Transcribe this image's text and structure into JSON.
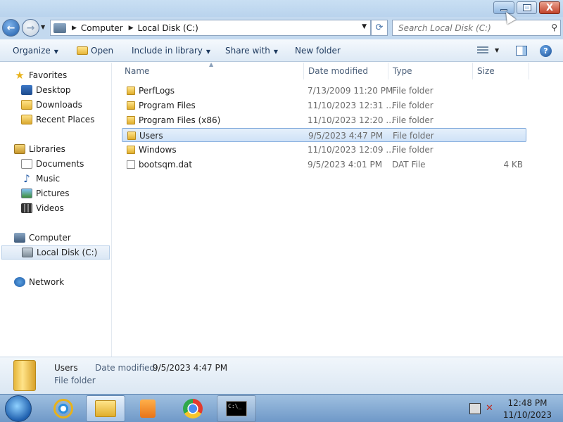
{
  "window": {
    "minimize_label": "–",
    "maximize_label": "",
    "close_label": "X"
  },
  "address": {
    "breadcrumb": [
      "Computer",
      "Local Disk (C:)"
    ],
    "search_placeholder": "Search Local Disk (C:)"
  },
  "toolbar": {
    "organize": "Organize",
    "open": "Open",
    "include_in_library": "Include in library",
    "share_with": "Share with",
    "new_folder": "New folder",
    "help": "?"
  },
  "nav": {
    "favorites": "Favorites",
    "desktop": "Desktop",
    "downloads": "Downloads",
    "recent_places": "Recent Places",
    "libraries": "Libraries",
    "documents": "Documents",
    "music": "Music",
    "pictures": "Pictures",
    "videos": "Videos",
    "computer": "Computer",
    "local_disk": "Local Disk (C:)",
    "network": "Network"
  },
  "columns": {
    "name": "Name",
    "date_modified": "Date modified",
    "type": "Type",
    "size": "Size"
  },
  "files": [
    {
      "name": "PerfLogs",
      "date": "7/13/2009 11:20 PM",
      "type": "File folder",
      "size": "",
      "icon": "folder-icon"
    },
    {
      "name": "Program Files",
      "date": "11/10/2023 12:31 ...",
      "type": "File folder",
      "size": "",
      "icon": "folder-icon"
    },
    {
      "name": "Program Files (x86)",
      "date": "11/10/2023 12:20 ...",
      "type": "File folder",
      "size": "",
      "icon": "folder-icon"
    },
    {
      "name": "Users",
      "date": "9/5/2023 4:47 PM",
      "type": "File folder",
      "size": "",
      "icon": "folder-icon"
    },
    {
      "name": "Windows",
      "date": "11/10/2023 12:09 ...",
      "type": "File folder",
      "size": "",
      "icon": "folder-icon"
    },
    {
      "name": "bootsqm.dat",
      "date": "9/5/2023 4:01 PM",
      "type": "DAT File",
      "size": "4 KB",
      "icon": "file-icon"
    }
  ],
  "details": {
    "name": "Users",
    "type": "File folder",
    "modified_label": "Date modified:",
    "modified_value": "9/5/2023 4:47 PM"
  },
  "taskbar": {
    "cmd_label": "C:\\_",
    "clock_time": "12:48 PM",
    "clock_date": "11/10/2023"
  },
  "colors": {
    "selection": "#cfe2f7",
    "selection_border": "#84acdd",
    "taskbar": "#6f99c8"
  }
}
